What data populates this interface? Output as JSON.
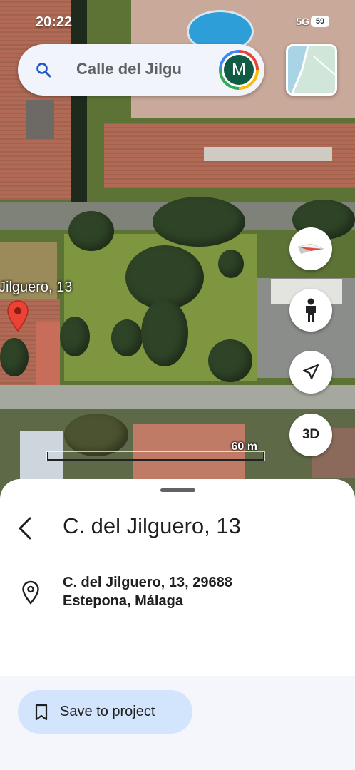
{
  "status_bar": {
    "time": "20:22",
    "network": "5G",
    "battery": "59"
  },
  "search": {
    "query": "Calle del Jilgu",
    "avatar_initial": "M"
  },
  "map": {
    "place_label": "Jilguero, 13",
    "scale_label": "60 m",
    "controls": {
      "compass": "compass-icon",
      "street_view": "pegman-icon",
      "my_location": "navigation-icon",
      "three_d_label": "3D"
    }
  },
  "sheet": {
    "title": "C. del Jilguero, 13",
    "address_line1": "C. del Jilguero, 13, 29688",
    "address_line2": "Estepona, Málaga",
    "save_button_label": "Save to project"
  },
  "colors": {
    "pin_red": "#ea4335",
    "save_button_bg": "#d3e4fd",
    "search_bg": "#f1f4fb"
  }
}
